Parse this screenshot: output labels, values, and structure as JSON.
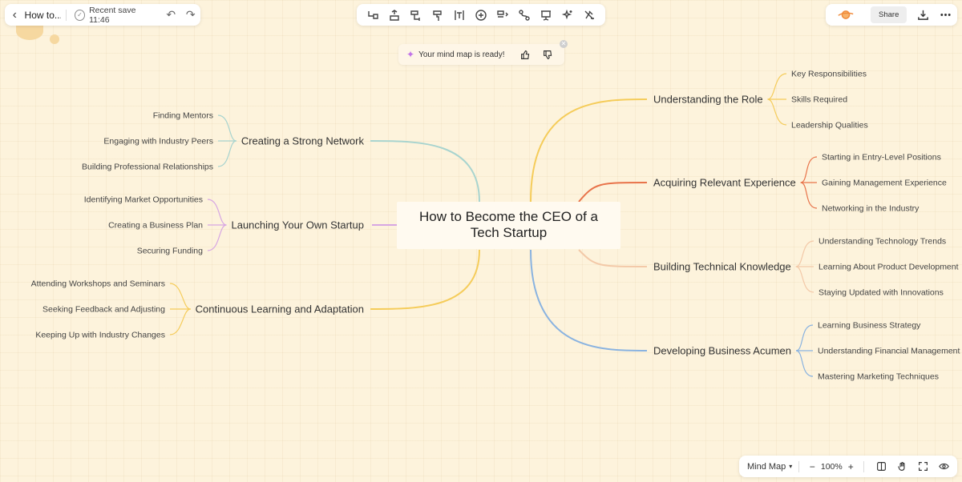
{
  "header": {
    "doc_title": "How to...",
    "save_status": "Recent save 11:46"
  },
  "toolbar": {
    "tools": [
      "add-child-icon",
      "add-sibling-icon",
      "layout-icon",
      "format-painter-icon",
      "text-icon",
      "insert-icon",
      "outline-icon",
      "connect-icon",
      "present-icon",
      "ai-magic-icon",
      "clear-format-icon"
    ]
  },
  "top_right": {
    "share_label": "Share"
  },
  "toast": {
    "message": "Your mind map is ready!"
  },
  "mindmap": {
    "root": "How to Become the CEO of a Tech Startup",
    "root_lines": [
      "How to Become the CEO of a",
      "Tech Startup"
    ],
    "branches": [
      {
        "label": "Understanding the Role",
        "color": "#f5cc5a",
        "side": "right",
        "children": [
          "Key Responsibilities",
          "Skills Required",
          "Leadership Qualities"
        ]
      },
      {
        "label": "Acquiring Relevant Experience",
        "color": "#e8734a",
        "side": "right",
        "children": [
          "Starting in Entry-Level Positions",
          "Gaining Management Experience",
          "Networking in the Industry"
        ]
      },
      {
        "label": "Building Technical Knowledge",
        "color": "#f3c9a8",
        "side": "right",
        "children": [
          "Understanding Technology Trends",
          "Learning About Product Development",
          "Staying Updated with Innovations"
        ]
      },
      {
        "label": "Developing Business Acumen",
        "color": "#8ab3e0",
        "side": "right",
        "children": [
          "Learning Business Strategy",
          "Understanding Financial Management",
          "Mastering Marketing Techniques"
        ]
      },
      {
        "label": "Creating a Strong Network",
        "color": "#a8d4cf",
        "side": "left",
        "children": [
          "Finding Mentors",
          "Engaging with Industry Peers",
          "Building Professional Relationships"
        ]
      },
      {
        "label": "Launching Your Own Startup",
        "color": "#d7a6e3",
        "side": "left",
        "children": [
          "Identifying Market Opportunities",
          "Creating a Business Plan",
          "Securing Funding"
        ]
      },
      {
        "label": "Continuous Learning and Adaptation",
        "color": "#f5cc5a",
        "side": "left",
        "children": [
          "Attending Workshops and Seminars",
          "Seeking Feedback and Adjusting",
          "Keeping Up with Industry Changes"
        ]
      }
    ]
  },
  "bottom_bar": {
    "mode_label": "Mind Map",
    "zoom_label": "100%"
  },
  "colors": {
    "background": "#fdf3dc",
    "accent_purple": "#c173e8"
  }
}
